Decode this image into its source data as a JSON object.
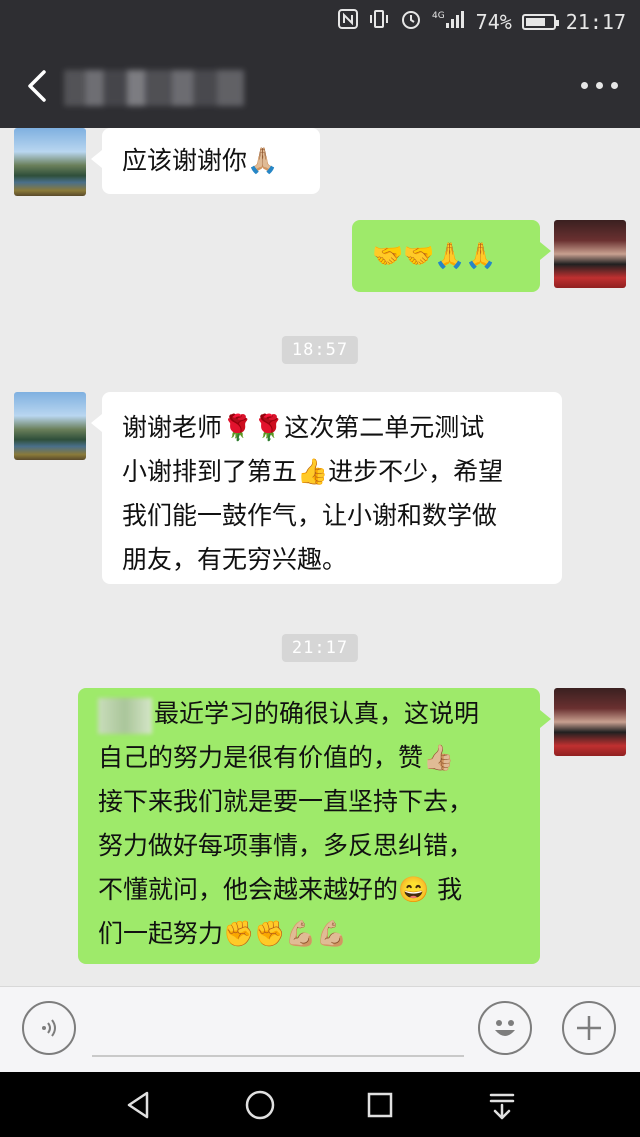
{
  "status_bar": {
    "icons": [
      "nfc-icon",
      "vibrate-icon",
      "alarm-icon",
      "signal-4g-icon"
    ],
    "network": "4G",
    "battery_percent": "74%",
    "battery_level": 0.74,
    "time": "21:17"
  },
  "header": {
    "back_icon": "chevron-left-icon",
    "contact_name": "",
    "more_icon": "more-dots-icon"
  },
  "messages": [
    {
      "side": "left",
      "avatar": "landscape",
      "text": "应该谢谢你🙏🏼"
    },
    {
      "side": "right",
      "avatar": "couple",
      "text": "🤝🤝🙏🙏"
    },
    {
      "type": "timestamp",
      "text": "18:57"
    },
    {
      "side": "left",
      "avatar": "landscape",
      "lines": [
        "谢谢老师🌹🌹这次第二单元测试",
        "小谢排到了第五👍进步不少，希望",
        "我们能一鼓作气，让小谢和数学做",
        "朋友，有无穷兴趣。"
      ]
    },
    {
      "type": "timestamp",
      "text": "21:17"
    },
    {
      "side": "right",
      "avatar": "couple",
      "lines": [
        "最近学习的确很认真，这说明",
        "自己的努力是很有价值的，赞👍🏼",
        "接下来我们就是要一直坚持下去，",
        "努力做好每项事情，多反思纠错，",
        "不懂就问，他会越来越好的😄 我",
        "们一起努力✊✊💪🏼💪🏼"
      ]
    }
  ],
  "input_bar": {
    "voice_icon": "voice-icon",
    "emoji_icon": "emoji-face-icon",
    "plus_icon": "plus-icon",
    "placeholder": ""
  },
  "system_nav": {
    "back_icon": "nav-back-triangle-icon",
    "home_icon": "nav-home-circle-icon",
    "recents_icon": "nav-recents-square-icon",
    "notification_icon": "nav-pulldown-icon"
  },
  "colors": {
    "header_bg": "#2e2e32",
    "chat_bg": "#ebebeb",
    "bubble_left": "#ffffff",
    "bubble_right": "#9eea6a",
    "timestamp_bg": "#d6d6d6"
  }
}
